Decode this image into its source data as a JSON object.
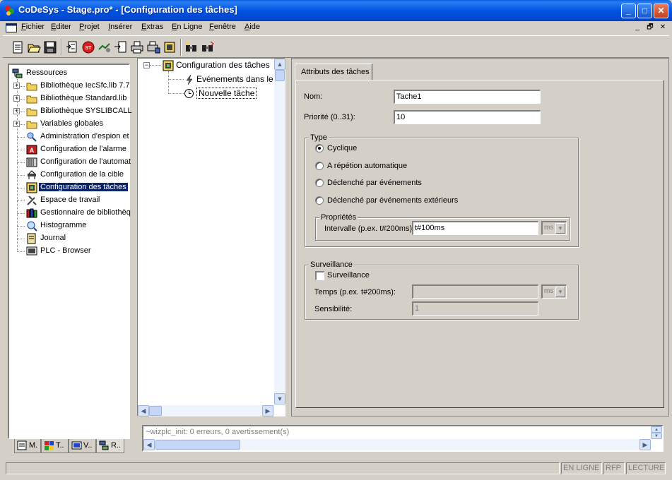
{
  "window": {
    "title": "CoDeSys - Stage.pro* - [Configuration des tâches]",
    "controls": {
      "minimize": "_",
      "maximize": "□",
      "close": "✕"
    }
  },
  "menubar": {
    "items": [
      "Fichier",
      "Editer",
      "Projet",
      "Insérer",
      "Extras",
      "En Ligne",
      "Fenêtre",
      "Aide"
    ],
    "mdi_controls": [
      "_",
      "🗗",
      "✕"
    ]
  },
  "toolbar": {
    "buttons": [
      "new-icon",
      "open-icon",
      "save-icon",
      "build-icon",
      "stop-icon",
      "login-icon",
      "logout-icon",
      "print-icon",
      "print-preview-icon",
      "find-icon",
      "replace-icon"
    ]
  },
  "resources_tree": {
    "root": "Ressources",
    "items": [
      {
        "label": "Bibliothèque IecSfc.lib 7.7",
        "icon": "folder-icon",
        "expandable": true
      },
      {
        "label": "Bibliothèque Standard.lib",
        "icon": "folder-icon",
        "expandable": true
      },
      {
        "label": "Bibliothèque SYSLIBCALL",
        "icon": "folder-icon",
        "expandable": true
      },
      {
        "label": "Variables globales",
        "icon": "folder-icon",
        "expandable": true
      },
      {
        "label": "Administration d'espion et",
        "icon": "watch-icon",
        "expandable": false
      },
      {
        "label": "Configuration de l'alarme",
        "icon": "alarm-icon",
        "expandable": false
      },
      {
        "label": "Configuration de l'automat",
        "icon": "plc-config-icon",
        "expandable": false
      },
      {
        "label": "Configuration de la cible",
        "icon": "target-icon",
        "expandable": false
      },
      {
        "label": "Configuration des tâches",
        "icon": "task-config-icon",
        "expandable": false,
        "selected": true
      },
      {
        "label": "Espace de travail",
        "icon": "tools-icon",
        "expandable": false
      },
      {
        "label": "Gestionnaire de bibliothèq",
        "icon": "library-icon",
        "expandable": false
      },
      {
        "label": "Histogramme",
        "icon": "histogram-icon",
        "expandable": false
      },
      {
        "label": "Journal",
        "icon": "journal-icon",
        "expandable": false
      },
      {
        "label": "PLC - Browser",
        "icon": "plc-browser-icon",
        "expandable": false
      }
    ]
  },
  "bottom_tabs": [
    {
      "label": "M.",
      "icon": "pou-icon"
    },
    {
      "label": "T..",
      "icon": "datatype-icon"
    },
    {
      "label": "V..",
      "icon": "visualization-icon"
    },
    {
      "label": "R..",
      "icon": "resources-icon"
    }
  ],
  "task_tree": {
    "root": "Configuration des tâches",
    "children": [
      "Evénements dans le",
      "Nouvelle tâche"
    ]
  },
  "task_attributes": {
    "tab_label": "Attributs des tâches",
    "name_label": "Nom:",
    "name_value": "Tache1",
    "priority_label": "Priorité (0..31):",
    "priority_value": "10",
    "type_group": "Type",
    "type_options": [
      {
        "label": "Cyclique",
        "selected": true
      },
      {
        "label": "A répétion automatique",
        "selected": false
      },
      {
        "label": "Déclenché par événements",
        "selected": false
      },
      {
        "label": "Déclenché par événements extérieurs",
        "selected": false
      }
    ],
    "properties_group": "Propriétés",
    "interval_label": "Intervalle (p.ex. t#200ms):",
    "interval_value": "t#100ms",
    "interval_unit": "ms",
    "watchdog_group": "Surveillance",
    "watchdog_check_label": "Surveillance",
    "watchdog_checked": false,
    "time_label": "Temps (p.ex. t#200ms):",
    "time_value": "",
    "time_unit": "ms",
    "sensitivity_label": "Sensibilité:",
    "sensitivity_value": "1"
  },
  "output": {
    "message": "~wizplc_init: 0 erreurs, 0 avertissement(s)"
  },
  "statusbar": {
    "online": "EN LIGNE",
    "rfp": "RFP",
    "read": "LECTURE"
  }
}
